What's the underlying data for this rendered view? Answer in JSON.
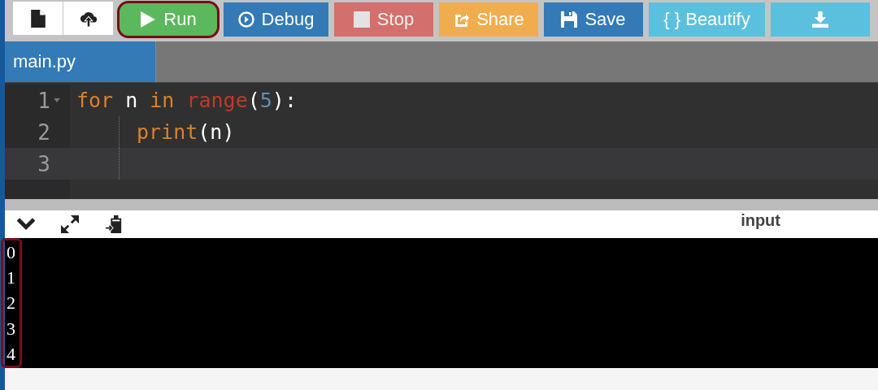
{
  "toolbar": {
    "file_buttons": [
      {
        "kind": "file"
      },
      {
        "kind": "upload"
      }
    ],
    "buttons": [
      {
        "kind": "run",
        "label": "Run",
        "highlighted": true,
        "disabled": false
      },
      {
        "kind": "debug",
        "label": "Debug",
        "highlighted": false,
        "disabled": false
      },
      {
        "kind": "stop",
        "label": "Stop",
        "highlighted": false,
        "disabled": true
      },
      {
        "kind": "share",
        "label": "Share",
        "highlighted": false,
        "disabled": false
      },
      {
        "kind": "save",
        "label": "Save",
        "highlighted": false,
        "disabled": false
      },
      {
        "kind": "beautify",
        "label": "{ } Beautify",
        "highlighted": false,
        "disabled": false
      },
      {
        "kind": "download",
        "highlighted": false,
        "disabled": false
      }
    ]
  },
  "tabs": [
    {
      "label": "main.py",
      "selected": true
    }
  ],
  "editor": {
    "lines": [
      {
        "number": "1",
        "foldable": true,
        "active": false,
        "indented": false,
        "tokens": [
          {
            "kind": "keyword",
            "text": "for"
          },
          {
            "kind": "plain",
            "text": " n "
          },
          {
            "kind": "keyword",
            "text": "in "
          },
          {
            "kind": "builtin",
            "text": "range"
          },
          {
            "kind": "paren",
            "text": "("
          },
          {
            "kind": "number",
            "text": "5"
          },
          {
            "kind": "paren",
            "text": ")"
          },
          {
            "kind": "plain",
            "text": ":"
          }
        ]
      },
      {
        "number": "2",
        "foldable": false,
        "active": false,
        "indented": true,
        "tokens": [
          {
            "kind": "keyword",
            "text": "print"
          },
          {
            "kind": "paren",
            "text": "("
          },
          {
            "kind": "plain",
            "text": "n"
          },
          {
            "kind": "paren",
            "text": ")"
          }
        ]
      },
      {
        "number": "3",
        "foldable": false,
        "active": true,
        "indented": true
      }
    ]
  },
  "console": {
    "tools": [
      {
        "kind": "collapse"
      },
      {
        "kind": "expand"
      },
      {
        "kind": "paste"
      }
    ],
    "input_label": "input",
    "output": [
      "0",
      "1",
      "2",
      "3",
      "4"
    ],
    "highlighted": true
  }
}
